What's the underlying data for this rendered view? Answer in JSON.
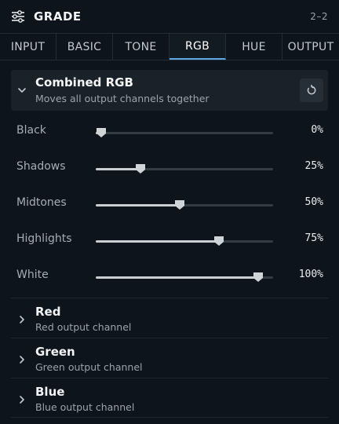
{
  "header": {
    "title": "GRADE",
    "page_indicator": "2–2"
  },
  "tabs": [
    {
      "label": "INPUT",
      "active": false
    },
    {
      "label": "BASIC",
      "active": false
    },
    {
      "label": "TONE",
      "active": false
    },
    {
      "label": "RGB",
      "active": true
    },
    {
      "label": "HUE",
      "active": false
    },
    {
      "label": "OUTPUT",
      "active": false
    }
  ],
  "combined": {
    "title": "Combined RGB",
    "subtitle": "Moves all output channels together",
    "sliders": [
      {
        "label": "Black",
        "value": 0,
        "value_text": "0%"
      },
      {
        "label": "Shadows",
        "value": 25,
        "value_text": "25%"
      },
      {
        "label": "Midtones",
        "value": 50,
        "value_text": "50%"
      },
      {
        "label": "Highlights",
        "value": 75,
        "value_text": "75%"
      },
      {
        "label": "White",
        "value": 100,
        "value_text": "100%"
      }
    ]
  },
  "channels": [
    {
      "title": "Red",
      "subtitle": "Red output channel"
    },
    {
      "title": "Green",
      "subtitle": "Green output channel"
    },
    {
      "title": "Blue",
      "subtitle": "Blue output channel"
    }
  ],
  "colors": {
    "accent": "#5aa9e6",
    "background": "#0e141b"
  },
  "icons": {
    "menu": "sliders-menu-icon",
    "expanded": "chevron-down-icon",
    "collapsed": "chevron-right-icon",
    "reset": "reset-icon",
    "thumb": "slider-thumb-icon"
  }
}
